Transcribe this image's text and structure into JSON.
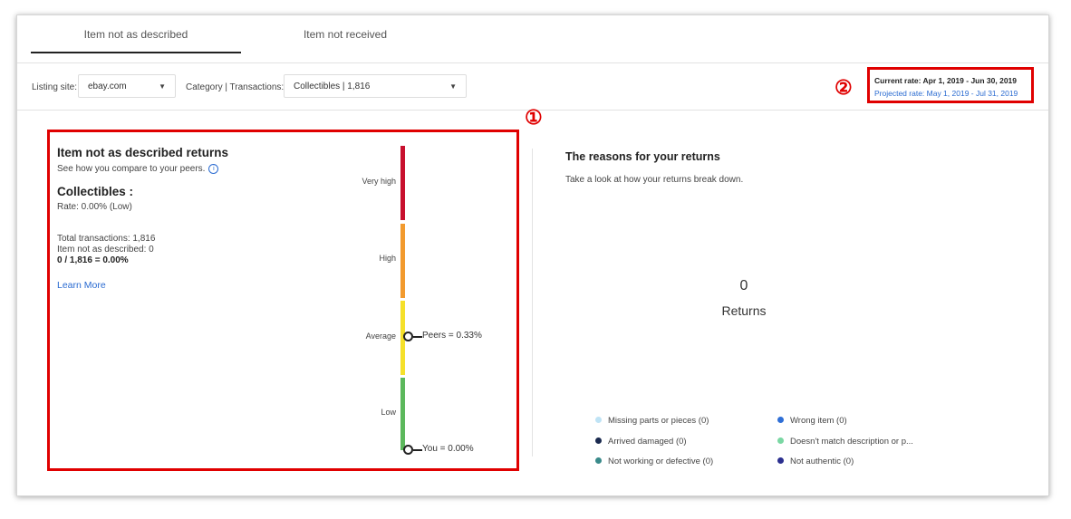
{
  "tabs": [
    {
      "label": "Item not as described",
      "active": true
    },
    {
      "label": "Item not received",
      "active": false
    }
  ],
  "filters": {
    "listing_site_label": "Listing site:",
    "listing_site_value": "ebay.com",
    "category_label": "Category | Transactions:",
    "category_value": "Collectibles | 1,816"
  },
  "rates": {
    "current": "Current rate: Apr 1, 2019 - Jun 30, 2019",
    "projected": "Projected rate: May 1, 2019 - Jul 31, 2019"
  },
  "markers": {
    "one": "①",
    "two": "②"
  },
  "left_panel": {
    "title": "Item not as described returns",
    "subtitle": "See how you compare to your peers.",
    "info_icon": "i",
    "category": "Collectibles :",
    "rate": "Rate: 0.00% (Low)",
    "total_transactions": "Total transactions: 1,816",
    "inad": "Item not as described: 0",
    "formula": "0 / 1,816 = 0.00%",
    "learn_more": "Learn More"
  },
  "meter": {
    "levels": [
      {
        "label": "Very high",
        "color": "#c8102e"
      },
      {
        "label": "High",
        "color": "#f29a2e"
      },
      {
        "label": "Average",
        "color": "#f5e02a"
      },
      {
        "label": "Low",
        "color": "#5cb85c"
      }
    ],
    "peers_label": "Peers = 0.33%",
    "you_label": "You = 0.00%"
  },
  "right_panel": {
    "title": "The reasons for your returns",
    "subtitle": "Take a look at how your returns break down.",
    "count": "0",
    "count_label": "Returns"
  },
  "legend": [
    {
      "label": "Missing parts or pieces (0)",
      "color": "#bfe3f5"
    },
    {
      "label": "Wrong item (0)",
      "color": "#2f6fd6"
    },
    {
      "label": "Arrived damaged (0)",
      "color": "#1a2a4f"
    },
    {
      "label": "Doesn't match description or p...",
      "color": "#7ad7a3"
    },
    {
      "label": "Not working or defective (0)",
      "color": "#3a8a8a"
    },
    {
      "label": "Not authentic (0)",
      "color": "#2b2f8f"
    }
  ]
}
